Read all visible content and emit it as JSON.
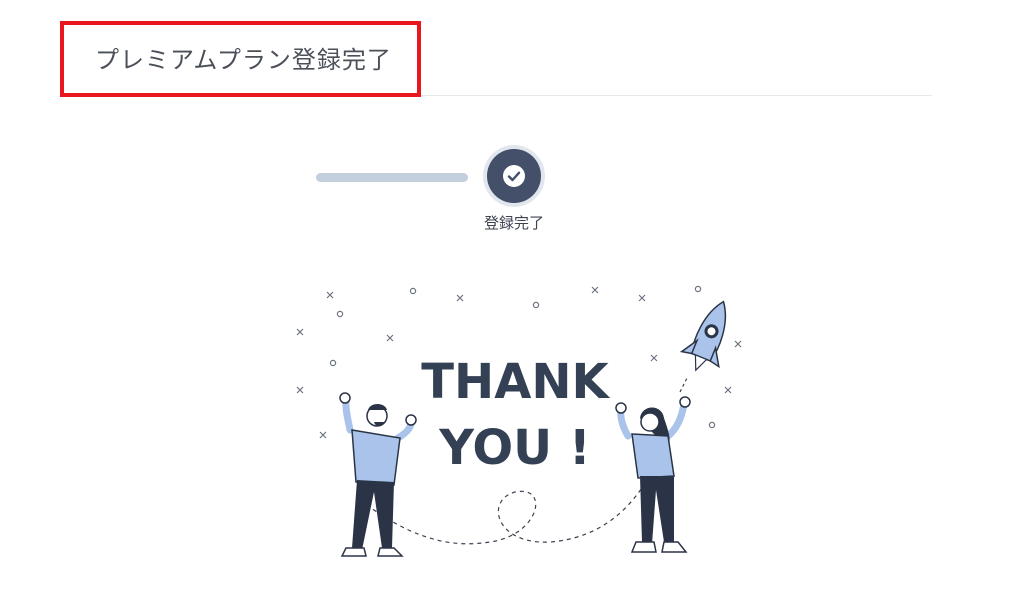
{
  "header": {
    "title": "プレミアムプラン登録完了"
  },
  "progress": {
    "steps": [
      {
        "label": "登録完了",
        "state": "completed"
      }
    ]
  },
  "illustration": {
    "line1": "THANK",
    "line2": "YOU !",
    "icons": [
      "person-cheering-icon",
      "woman-cheering-icon",
      "rocket-icon"
    ]
  },
  "colors": {
    "highlight_border": "#e8171d",
    "step_line": "#c4cfde",
    "step_completed": "#445069",
    "thank_you_text": "#344054",
    "figure_shirt": "#a9c3ea",
    "figure_pants": "#2b3446"
  }
}
